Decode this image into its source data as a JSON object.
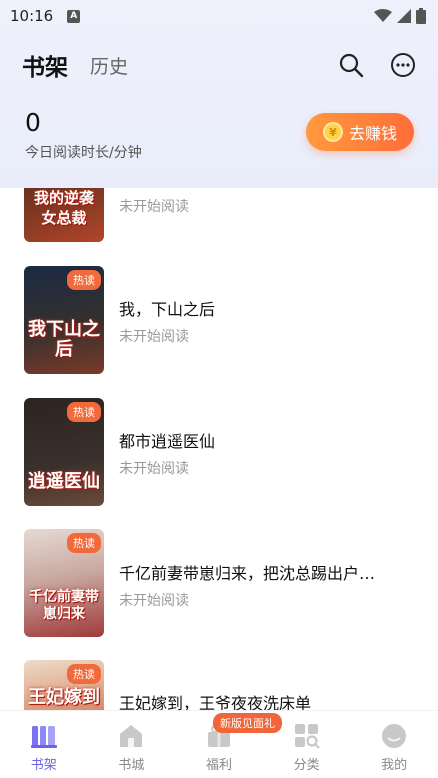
{
  "status_bar": {
    "time": "10:16",
    "notification_glyph": "A"
  },
  "header": {
    "tabs": [
      {
        "label": "书架",
        "active": true
      },
      {
        "label": "历史",
        "active": false
      }
    ],
    "icons": [
      "search-icon",
      "more-icon"
    ]
  },
  "stats": {
    "today_value": "0",
    "today_label": "今日阅读时长/分钟",
    "earn_button": "去赚钱",
    "coin_glyph": "¥"
  },
  "books": [
    {
      "title": "",
      "status": "未开始阅读",
      "badge": "",
      "cover_text": "我的逆袭女总裁",
      "cover_colors": [
        "#3a2418",
        "#b0452a"
      ]
    },
    {
      "title": "我，下山之后",
      "status": "未开始阅读",
      "badge": "热读",
      "cover_text": "我下山之后",
      "cover_colors": [
        "#1b2a44",
        "#7a3a2a"
      ]
    },
    {
      "title": "都市逍遥医仙",
      "status": "未开始阅读",
      "badge": "热读",
      "cover_text": "逍遥医仙",
      "cover_colors": [
        "#2c2420",
        "#6b4a3a"
      ]
    },
    {
      "title": "千亿前妻带崽归来，把沈总踢出户…",
      "status": "未开始阅读",
      "badge": "热读",
      "cover_text": "千亿前妻带崽归来",
      "cover_colors": [
        "#d8c8c0",
        "#a03a3a"
      ]
    },
    {
      "title": "王妃嫁到，王爷夜夜洗床单",
      "status": "",
      "badge": "热读",
      "cover_text": "王妃嫁到",
      "cover_colors": [
        "#e8d6c0",
        "#b8402a"
      ]
    }
  ],
  "bottom_nav": [
    {
      "label": "书架",
      "icon": "bookshelf-icon",
      "active": true,
      "badge": ""
    },
    {
      "label": "书城",
      "icon": "store-icon",
      "active": false,
      "badge": ""
    },
    {
      "label": "福利",
      "icon": "gift-icon",
      "active": false,
      "badge": "新版见面礼"
    },
    {
      "label": "分类",
      "icon": "category-icon",
      "active": false,
      "badge": ""
    },
    {
      "label": "我的",
      "icon": "profile-icon",
      "active": false,
      "badge": ""
    }
  ],
  "colors": {
    "accent": "#6a63e8",
    "orange": "#ff7a3a",
    "badge": "#f06a3c"
  }
}
